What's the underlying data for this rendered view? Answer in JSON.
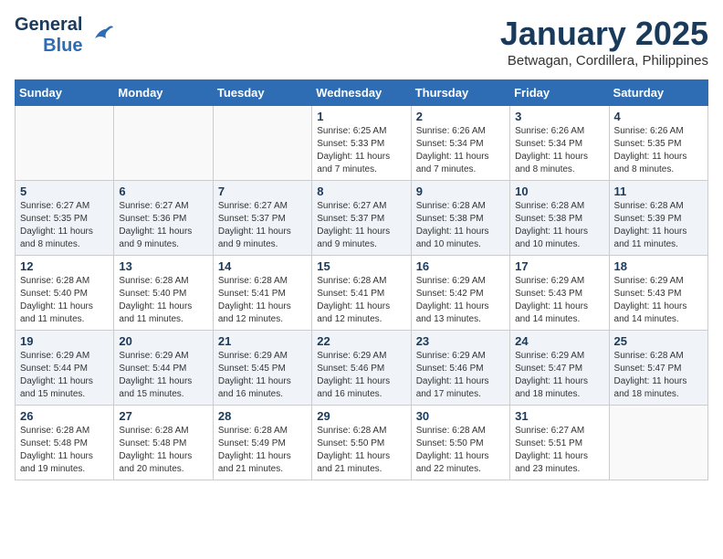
{
  "header": {
    "logo_general": "General",
    "logo_blue": "Blue",
    "month_title": "January 2025",
    "location": "Betwagan, Cordillera, Philippines"
  },
  "weekdays": [
    "Sunday",
    "Monday",
    "Tuesday",
    "Wednesday",
    "Thursday",
    "Friday",
    "Saturday"
  ],
  "weeks": [
    [
      {
        "day": "",
        "sunrise": "",
        "sunset": "",
        "daylight": ""
      },
      {
        "day": "",
        "sunrise": "",
        "sunset": "",
        "daylight": ""
      },
      {
        "day": "",
        "sunrise": "",
        "sunset": "",
        "daylight": ""
      },
      {
        "day": "1",
        "sunrise": "Sunrise: 6:25 AM",
        "sunset": "Sunset: 5:33 PM",
        "daylight": "Daylight: 11 hours and 7 minutes."
      },
      {
        "day": "2",
        "sunrise": "Sunrise: 6:26 AM",
        "sunset": "Sunset: 5:34 PM",
        "daylight": "Daylight: 11 hours and 7 minutes."
      },
      {
        "day": "3",
        "sunrise": "Sunrise: 6:26 AM",
        "sunset": "Sunset: 5:34 PM",
        "daylight": "Daylight: 11 hours and 8 minutes."
      },
      {
        "day": "4",
        "sunrise": "Sunrise: 6:26 AM",
        "sunset": "Sunset: 5:35 PM",
        "daylight": "Daylight: 11 hours and 8 minutes."
      }
    ],
    [
      {
        "day": "5",
        "sunrise": "Sunrise: 6:27 AM",
        "sunset": "Sunset: 5:35 PM",
        "daylight": "Daylight: 11 hours and 8 minutes."
      },
      {
        "day": "6",
        "sunrise": "Sunrise: 6:27 AM",
        "sunset": "Sunset: 5:36 PM",
        "daylight": "Daylight: 11 hours and 9 minutes."
      },
      {
        "day": "7",
        "sunrise": "Sunrise: 6:27 AM",
        "sunset": "Sunset: 5:37 PM",
        "daylight": "Daylight: 11 hours and 9 minutes."
      },
      {
        "day": "8",
        "sunrise": "Sunrise: 6:27 AM",
        "sunset": "Sunset: 5:37 PM",
        "daylight": "Daylight: 11 hours and 9 minutes."
      },
      {
        "day": "9",
        "sunrise": "Sunrise: 6:28 AM",
        "sunset": "Sunset: 5:38 PM",
        "daylight": "Daylight: 11 hours and 10 minutes."
      },
      {
        "day": "10",
        "sunrise": "Sunrise: 6:28 AM",
        "sunset": "Sunset: 5:38 PM",
        "daylight": "Daylight: 11 hours and 10 minutes."
      },
      {
        "day": "11",
        "sunrise": "Sunrise: 6:28 AM",
        "sunset": "Sunset: 5:39 PM",
        "daylight": "Daylight: 11 hours and 11 minutes."
      }
    ],
    [
      {
        "day": "12",
        "sunrise": "Sunrise: 6:28 AM",
        "sunset": "Sunset: 5:40 PM",
        "daylight": "Daylight: 11 hours and 11 minutes."
      },
      {
        "day": "13",
        "sunrise": "Sunrise: 6:28 AM",
        "sunset": "Sunset: 5:40 PM",
        "daylight": "Daylight: 11 hours and 11 minutes."
      },
      {
        "day": "14",
        "sunrise": "Sunrise: 6:28 AM",
        "sunset": "Sunset: 5:41 PM",
        "daylight": "Daylight: 11 hours and 12 minutes."
      },
      {
        "day": "15",
        "sunrise": "Sunrise: 6:28 AM",
        "sunset": "Sunset: 5:41 PM",
        "daylight": "Daylight: 11 hours and 12 minutes."
      },
      {
        "day": "16",
        "sunrise": "Sunrise: 6:29 AM",
        "sunset": "Sunset: 5:42 PM",
        "daylight": "Daylight: 11 hours and 13 minutes."
      },
      {
        "day": "17",
        "sunrise": "Sunrise: 6:29 AM",
        "sunset": "Sunset: 5:43 PM",
        "daylight": "Daylight: 11 hours and 14 minutes."
      },
      {
        "day": "18",
        "sunrise": "Sunrise: 6:29 AM",
        "sunset": "Sunset: 5:43 PM",
        "daylight": "Daylight: 11 hours and 14 minutes."
      }
    ],
    [
      {
        "day": "19",
        "sunrise": "Sunrise: 6:29 AM",
        "sunset": "Sunset: 5:44 PM",
        "daylight": "Daylight: 11 hours and 15 minutes."
      },
      {
        "day": "20",
        "sunrise": "Sunrise: 6:29 AM",
        "sunset": "Sunset: 5:44 PM",
        "daylight": "Daylight: 11 hours and 15 minutes."
      },
      {
        "day": "21",
        "sunrise": "Sunrise: 6:29 AM",
        "sunset": "Sunset: 5:45 PM",
        "daylight": "Daylight: 11 hours and 16 minutes."
      },
      {
        "day": "22",
        "sunrise": "Sunrise: 6:29 AM",
        "sunset": "Sunset: 5:46 PM",
        "daylight": "Daylight: 11 hours and 16 minutes."
      },
      {
        "day": "23",
        "sunrise": "Sunrise: 6:29 AM",
        "sunset": "Sunset: 5:46 PM",
        "daylight": "Daylight: 11 hours and 17 minutes."
      },
      {
        "day": "24",
        "sunrise": "Sunrise: 6:29 AM",
        "sunset": "Sunset: 5:47 PM",
        "daylight": "Daylight: 11 hours and 18 minutes."
      },
      {
        "day": "25",
        "sunrise": "Sunrise: 6:28 AM",
        "sunset": "Sunset: 5:47 PM",
        "daylight": "Daylight: 11 hours and 18 minutes."
      }
    ],
    [
      {
        "day": "26",
        "sunrise": "Sunrise: 6:28 AM",
        "sunset": "Sunset: 5:48 PM",
        "daylight": "Daylight: 11 hours and 19 minutes."
      },
      {
        "day": "27",
        "sunrise": "Sunrise: 6:28 AM",
        "sunset": "Sunset: 5:48 PM",
        "daylight": "Daylight: 11 hours and 20 minutes."
      },
      {
        "day": "28",
        "sunrise": "Sunrise: 6:28 AM",
        "sunset": "Sunset: 5:49 PM",
        "daylight": "Daylight: 11 hours and 21 minutes."
      },
      {
        "day": "29",
        "sunrise": "Sunrise: 6:28 AM",
        "sunset": "Sunset: 5:50 PM",
        "daylight": "Daylight: 11 hours and 21 minutes."
      },
      {
        "day": "30",
        "sunrise": "Sunrise: 6:28 AM",
        "sunset": "Sunset: 5:50 PM",
        "daylight": "Daylight: 11 hours and 22 minutes."
      },
      {
        "day": "31",
        "sunrise": "Sunrise: 6:27 AM",
        "sunset": "Sunset: 5:51 PM",
        "daylight": "Daylight: 11 hours and 23 minutes."
      },
      {
        "day": "",
        "sunrise": "",
        "sunset": "",
        "daylight": ""
      }
    ]
  ]
}
